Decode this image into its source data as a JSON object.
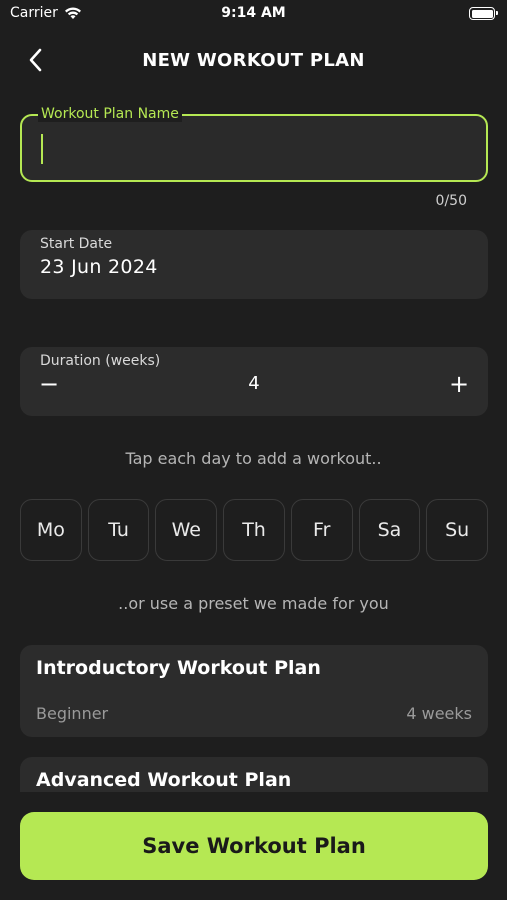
{
  "status_bar": {
    "carrier": "Carrier",
    "time": "9:14 AM"
  },
  "header": {
    "title": "NEW WORKOUT PLAN"
  },
  "plan_name": {
    "label": "Workout Plan Name",
    "value": "",
    "counter": "0/50"
  },
  "start_date": {
    "label": "Start Date",
    "value": "23 Jun 2024"
  },
  "duration": {
    "label": "Duration (weeks)",
    "value": "4",
    "minus": "−",
    "plus": "+"
  },
  "days_hint": "Tap each day to add a workout..",
  "days": [
    "Mo",
    "Tu",
    "We",
    "Th",
    "Fr",
    "Sa",
    "Su"
  ],
  "preset_hint": "..or use a preset we made for you",
  "presets": [
    {
      "title": "Introductory Workout Plan",
      "level": "Beginner",
      "duration": "4 weeks"
    },
    {
      "title": "Advanced Workout Plan"
    }
  ],
  "save_button": "Save Workout Plan",
  "colors": {
    "accent": "#b5e853",
    "background": "#1e1e1e",
    "card": "#2c2c2c"
  }
}
